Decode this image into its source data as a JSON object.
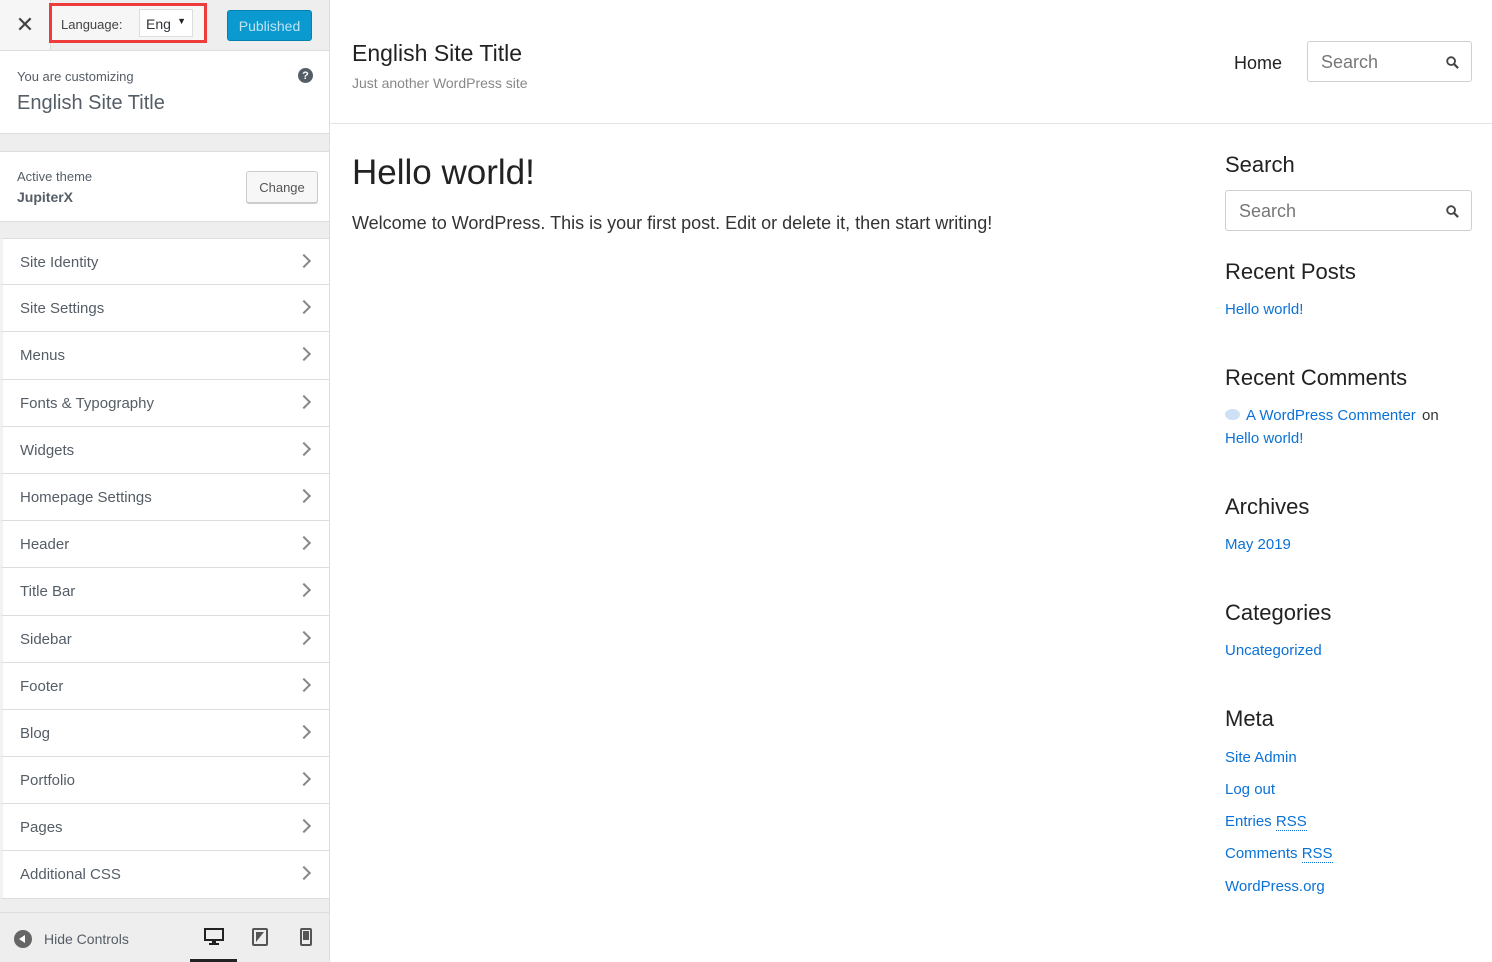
{
  "topbar": {
    "close_symbol": "✕",
    "language_label": "Language:",
    "language_value": "Eng",
    "language_caret": "▼",
    "publish_label": "Published"
  },
  "info": {
    "customizing_label": "You are customizing",
    "site_title": "English Site Title",
    "help_symbol": "?"
  },
  "theme": {
    "active_label": "Active theme",
    "name": "JupiterX",
    "change_label": "Change"
  },
  "menu": {
    "items": [
      {
        "label": "Site Identity"
      },
      {
        "label": "Site Settings"
      },
      {
        "label": "Menus"
      },
      {
        "label": "Fonts & Typography"
      },
      {
        "label": "Widgets"
      },
      {
        "label": "Homepage Settings"
      },
      {
        "label": "Header"
      },
      {
        "label": "Title Bar"
      },
      {
        "label": "Sidebar"
      },
      {
        "label": "Footer"
      },
      {
        "label": "Blog"
      },
      {
        "label": "Portfolio"
      },
      {
        "label": "Pages"
      },
      {
        "label": "Additional CSS"
      }
    ]
  },
  "footer": {
    "hide_controls_label": "Hide Controls",
    "devices": [
      "desktop-icon",
      "tablet-icon",
      "mobile-icon"
    ],
    "active_device": "desktop"
  },
  "site": {
    "title": "English Site Title",
    "tagline": "Just another WordPress site",
    "nav_home": "Home",
    "search_placeholder": "Search"
  },
  "post": {
    "title": "Hello world!",
    "body": "Welcome to WordPress. This is your first post. Edit or delete it, then start writing!"
  },
  "widgets": {
    "search_title": "Search",
    "search_placeholder": "Search",
    "recent_posts_title": "Recent Posts",
    "recent_posts": [
      "Hello world!"
    ],
    "recent_comments_title": "Recent Comments",
    "comment_author": "A WordPress Commenter",
    "comment_on": "on",
    "comment_post": "Hello world!",
    "archives_title": "Archives",
    "archives": [
      "May 2019"
    ],
    "categories_title": "Categories",
    "categories": [
      "Uncategorized"
    ],
    "meta_title": "Meta",
    "meta_links": [
      "Site Admin",
      "Log out",
      "Entries",
      "Comments",
      "WordPress.org"
    ],
    "rss_abbr": "RSS"
  },
  "colors": {
    "accent_blue": "#0a9ad0",
    "link_blue": "#0a72d6",
    "highlight_red": "#ee3b3b"
  }
}
